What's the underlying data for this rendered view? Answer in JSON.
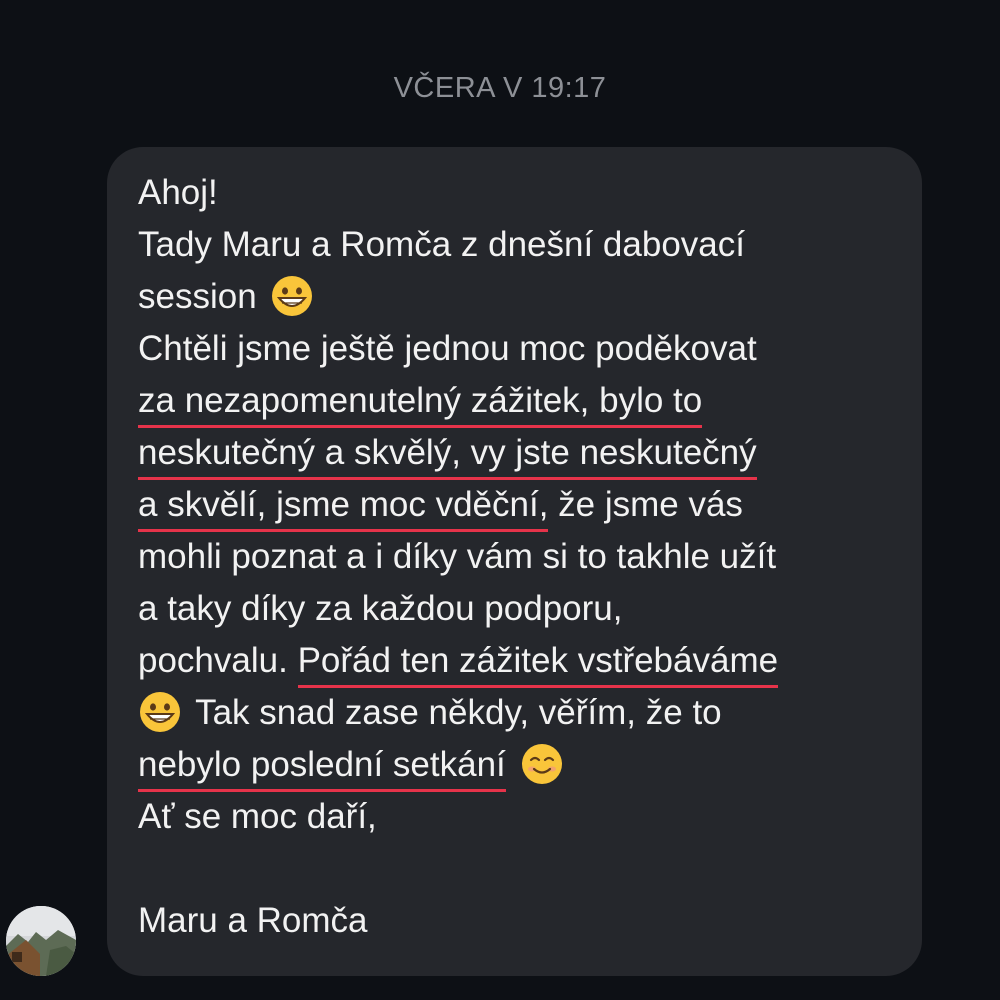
{
  "conversation": {
    "timestamp": "VČERA V 19:17"
  },
  "message": {
    "lines": [
      "Ahoj!",
      "Tady Maru a Romča z dnešní dabovací",
      "session",
      "Chtěli jsme ještě jednou moc poděkovat",
      "za nezapomenutelný zážitek, bylo to",
      "neskutečný a skvělý, vy jste neskutečný",
      "a skvělí, jsme moc vděční,",
      " že jsme vás",
      "mohli poznat a i díky vám si to takhle užít",
      "a taky díky za každou podporu,",
      "pochvalu. ",
      "Pořád ten zážitek vstřebáváme",
      " Tak snad zase někdy, věřím, že to",
      "nebylo poslední setkání",
      "Ať se moc daří,",
      "Maru a Romča"
    ],
    "emojis": [
      "grinning-face",
      "grinning-face",
      "smiling-face"
    ]
  },
  "colors": {
    "background": "#0d1015",
    "bubble": "#25272c",
    "text": "#f2f2f2",
    "timestamp": "#8d9096",
    "underline": "#e6334a"
  },
  "sender": {
    "avatar_icon": "avatar-photo"
  }
}
